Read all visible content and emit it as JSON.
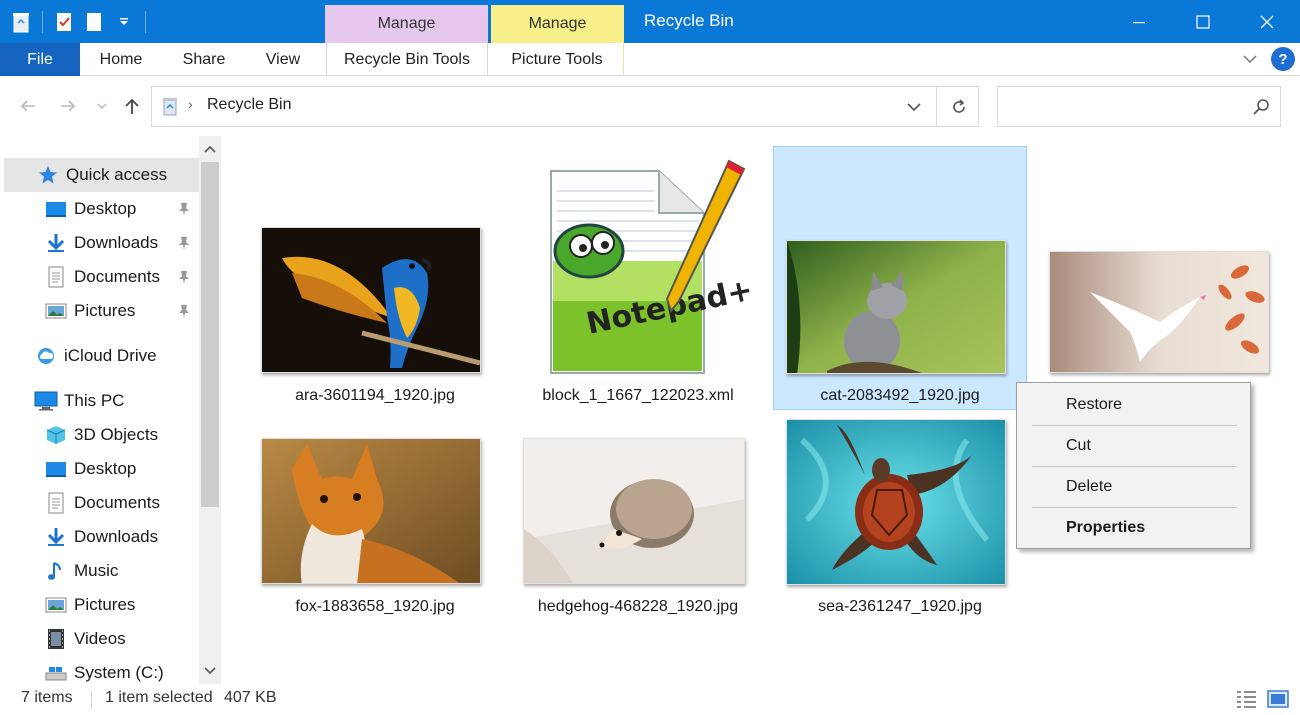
{
  "titlebar": {
    "title": "Recycle Bin",
    "context_tabs": [
      {
        "label": "Manage",
        "color": "#e6c8ef"
      },
      {
        "label": "Manage",
        "color": "#f6ef8a"
      }
    ]
  },
  "ribbon": {
    "tabs": [
      "File",
      "Home",
      "Share",
      "View",
      "Recycle Bin Tools",
      "Picture Tools"
    ],
    "help_label": "?"
  },
  "address": {
    "location": "Recycle Bin",
    "separator": "›",
    "search_placeholder": ""
  },
  "sidebar": {
    "quick_access": "Quick access",
    "pinned": [
      {
        "label": "Desktop",
        "icon": "desktop-icon"
      },
      {
        "label": "Downloads",
        "icon": "download-icon"
      },
      {
        "label": "Documents",
        "icon": "documents-icon"
      },
      {
        "label": "Pictures",
        "icon": "pictures-icon"
      }
    ],
    "icloud": "iCloud Drive",
    "this_pc": "This PC",
    "pc_items": [
      {
        "label": "3D Objects",
        "icon": "3d-objects-icon"
      },
      {
        "label": "Desktop",
        "icon": "desktop-icon"
      },
      {
        "label": "Documents",
        "icon": "documents-icon"
      },
      {
        "label": "Downloads",
        "icon": "download-icon"
      },
      {
        "label": "Music",
        "icon": "music-icon"
      },
      {
        "label": "Pictures",
        "icon": "pictures-icon"
      },
      {
        "label": "Videos",
        "icon": "videos-icon"
      },
      {
        "label": "System (C:)",
        "icon": "drive-icon"
      }
    ]
  },
  "files": [
    {
      "name": "ara-3601194_1920.jpg",
      "kind": "parrot",
      "selected": false
    },
    {
      "name": "block_1_1667_122023.xml",
      "kind": "notepad",
      "selected": false
    },
    {
      "name": "cat-2083492_1920.jpg",
      "kind": "cat",
      "selected": true
    },
    {
      "name": "",
      "kind": "dove",
      "selected": false
    },
    {
      "name": "fox-1883658_1920.jpg",
      "kind": "fox",
      "selected": false
    },
    {
      "name": "hedgehog-468228_1920.jpg",
      "kind": "hedgehog",
      "selected": false
    },
    {
      "name": "sea-2361247_1920.jpg",
      "kind": "turtle",
      "selected": false
    }
  ],
  "context_menu": {
    "items": [
      "Restore",
      "Cut",
      "Delete",
      "Properties"
    ]
  },
  "status": {
    "count": "7 items",
    "selection": "1 item selected",
    "size": "407 KB"
  },
  "colors": {
    "titlebar": "#0a78d7",
    "file_tab": "#1565c0",
    "selection": "#cce8ff"
  }
}
